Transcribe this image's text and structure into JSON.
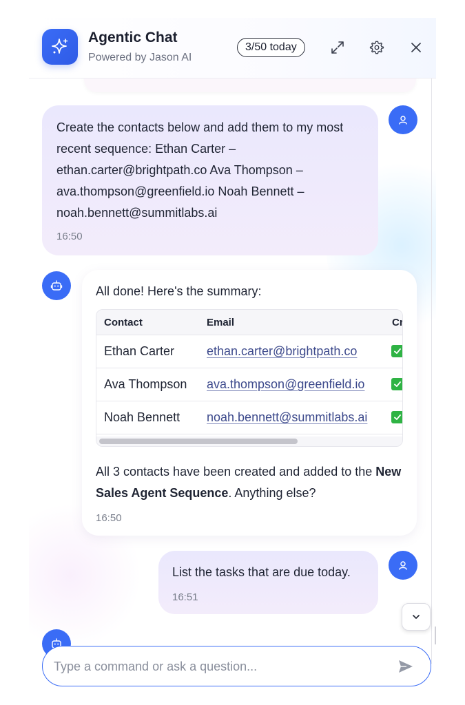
{
  "header": {
    "title": "Agentic Chat",
    "subtitle": "Powered by Jason AI",
    "quota": "3/50 today",
    "icons": [
      "sparkle-icon",
      "expand-icon",
      "gear-icon",
      "close-icon"
    ]
  },
  "messages": [
    {
      "role": "user",
      "text": "Create the contacts below and add them to my most recent sequence:  Ethan Carter – ethan.carter@brightpath.co Ava Thompson – ava.thompson@greenfield.io Noah Bennett – noah.bennett@summitlabs.ai",
      "time": "16:50"
    },
    {
      "role": "assistant",
      "intro": "All done! Here's the summary:",
      "table": {
        "headers": [
          "Contact",
          "Email",
          "Cr"
        ],
        "rows": [
          {
            "contact": "Ethan Carter",
            "email": "ethan.carter@brightpath.co"
          },
          {
            "contact": "Ava Thompson",
            "email": "ava.thompson@greenfield.io"
          },
          {
            "contact": "Noah Bennett",
            "email": "noah.bennett@summitlabs.ai"
          }
        ]
      },
      "outro_before": "All 3 contacts have been created and added to the ",
      "outro_bold": "New Sales Agent Sequence",
      "outro_after": ". Anything else?",
      "time": "16:50"
    },
    {
      "role": "user",
      "text": "List the tasks that are due today.",
      "time": "16:51"
    }
  ],
  "input": {
    "placeholder": "Type a command or ask a question..."
  },
  "colors": {
    "accent": "#3a6cf6",
    "check": "#2fb344"
  }
}
